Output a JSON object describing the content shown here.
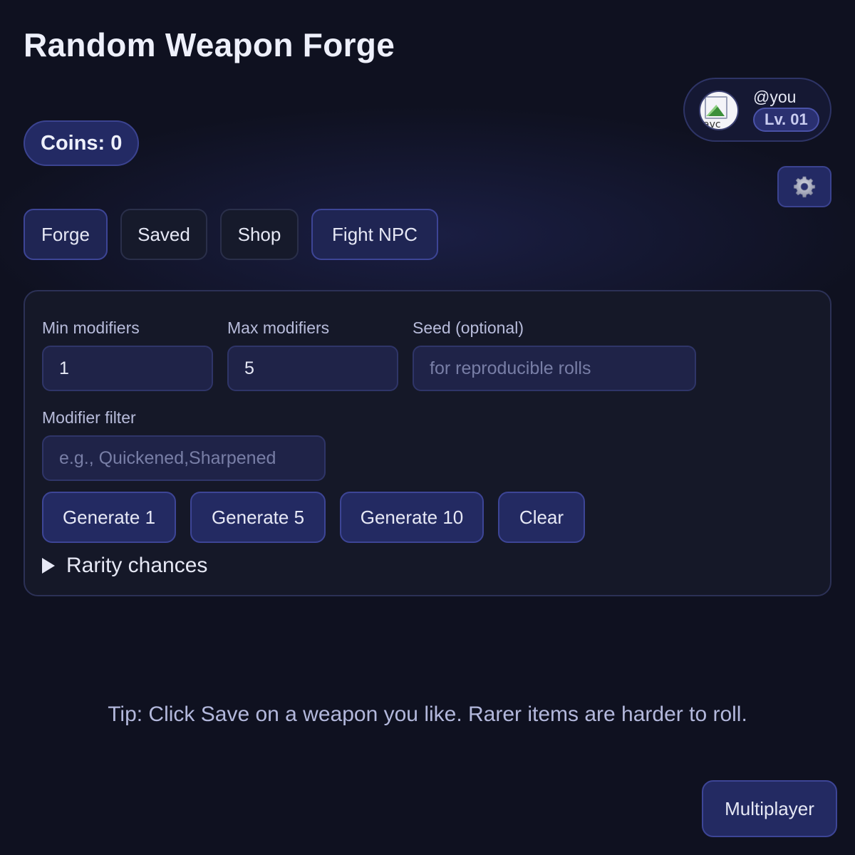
{
  "app": {
    "title": "Random Weapon Forge"
  },
  "coins": {
    "label": "Coins: 0"
  },
  "profile": {
    "handle": "@you",
    "level": "Lv. 01",
    "avatar_alt": "avc"
  },
  "settings": {
    "icon": "gear-icon"
  },
  "tabs": [
    {
      "label": "Forge"
    },
    {
      "label": "Saved"
    },
    {
      "label": "Shop"
    },
    {
      "label": "Fight NPC"
    }
  ],
  "form": {
    "min_modifiers": {
      "label": "Min modifiers",
      "value": "1"
    },
    "max_modifiers": {
      "label": "Max modifiers",
      "value": "5"
    },
    "seed": {
      "label": "Seed (optional)",
      "value": "",
      "placeholder": "for reproducible rolls"
    },
    "filter": {
      "label": "Modifier filter",
      "value": "",
      "placeholder": "e.g., Quickened,Sharpened"
    }
  },
  "actions": {
    "generate_1": "Generate 1",
    "generate_5": "Generate 5",
    "generate_10": "Generate 10",
    "clear": "Clear"
  },
  "rarity": {
    "label": "Rarity chances"
  },
  "tip": "Tip: Click Save on a weapon you like. Rarer items are harder to roll.",
  "multiplayer": {
    "label": "Multiplayer"
  },
  "colors": {
    "background": "#0f1120",
    "panel": "#151828",
    "accent_button": "#232a62",
    "accent_border": "#3d4596"
  }
}
